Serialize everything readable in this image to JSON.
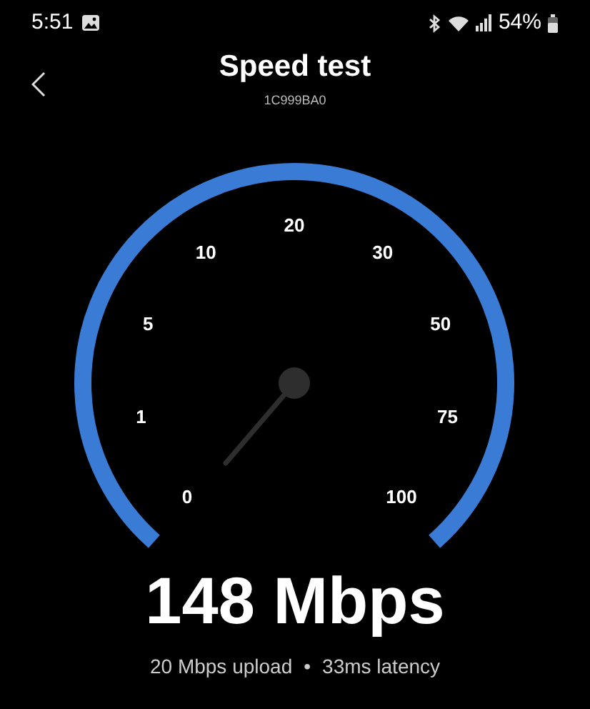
{
  "status_bar": {
    "time": "5:51",
    "battery_text": "54%"
  },
  "header": {
    "title": "Speed test",
    "subtitle": "1C999BA0"
  },
  "gauge": {
    "scale_labels": [
      "0",
      "1",
      "5",
      "10",
      "20",
      "30",
      "50",
      "75",
      "100"
    ]
  },
  "result": {
    "speed": "148 Mbps",
    "upload": "20 Mbps upload",
    "separator": "•",
    "latency": "33ms latency"
  }
}
